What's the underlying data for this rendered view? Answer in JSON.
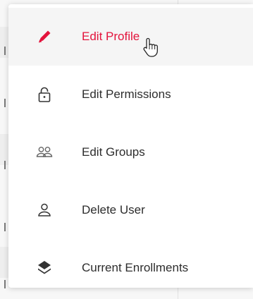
{
  "menu": {
    "items": [
      {
        "label": "Edit Profile",
        "icon": "pencil-icon",
        "active": true
      },
      {
        "label": "Edit Permissions",
        "icon": "lock-icon",
        "active": false
      },
      {
        "label": "Edit Groups",
        "icon": "users-icon",
        "active": false
      },
      {
        "label": "Delete User",
        "icon": "user-icon",
        "active": false
      },
      {
        "label": "Current Enrollments",
        "icon": "layers-icon",
        "active": false
      }
    ]
  },
  "colors": {
    "accent": "#e3143c",
    "text": "#2d2d2d",
    "icon": "#333333",
    "hover_background": "#f5f5f5"
  },
  "cursor": {
    "type": "hand-pointer"
  }
}
